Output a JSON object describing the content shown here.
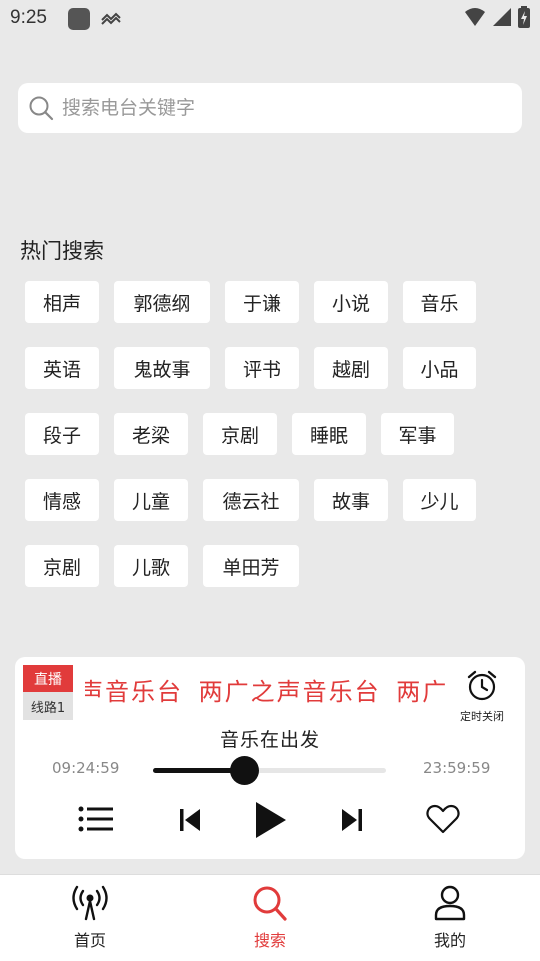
{
  "status_bar": {
    "time": "9:25"
  },
  "search": {
    "placeholder": "搜索电台关键字"
  },
  "hot_search": {
    "title": "热门搜索",
    "tags": [
      "相声",
      "郭德纲",
      "于谦",
      "小说",
      "音乐",
      "英语",
      "鬼故事",
      "评书",
      "越剧",
      "小品",
      "段子",
      "老梁",
      "京剧",
      "睡眠",
      "军事",
      "情感",
      "儿童",
      "德云社",
      "故事",
      "少儿",
      "京剧",
      "儿歌",
      "单田芳"
    ]
  },
  "player": {
    "live_label": "直播",
    "line_label": "线路1",
    "station_marquee": "两广之声音乐台 两广之声音乐台 两广之声音乐台",
    "timer_label": "定时关闭",
    "program_title": "音乐在出发",
    "time_start": "09:24:59",
    "time_end": "23:59:59",
    "progress": 0.39,
    "accent_color": "#e13b3b"
  },
  "bottom_nav": {
    "items": [
      {
        "label": "首页",
        "icon": "radio-tower-icon",
        "active": false
      },
      {
        "label": "搜索",
        "icon": "search-icon",
        "active": true
      },
      {
        "label": "我的",
        "icon": "user-icon",
        "active": false
      }
    ],
    "active_color": "#e13b3b"
  }
}
